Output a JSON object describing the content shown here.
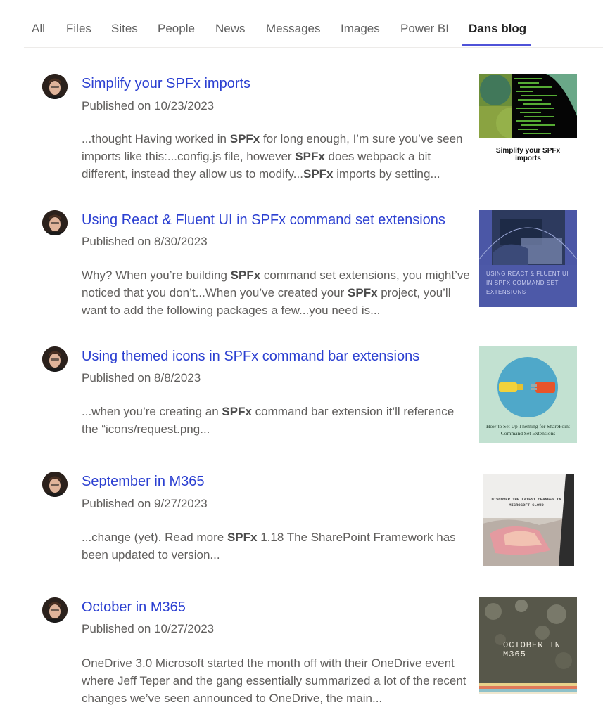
{
  "tabs": [
    {
      "label": "All"
    },
    {
      "label": "Files"
    },
    {
      "label": "Sites"
    },
    {
      "label": "People"
    },
    {
      "label": "News"
    },
    {
      "label": "Messages"
    },
    {
      "label": "Images"
    },
    {
      "label": "Power BI"
    },
    {
      "label": "Dans blog",
      "active": true
    }
  ],
  "published_prefix": "Published on",
  "results": [
    {
      "title": "Simplify your SPFx imports",
      "date": "10/23/2023",
      "snippet": [
        {
          "t": "...thought Having worked in "
        },
        {
          "t": "SPFx",
          "b": true
        },
        {
          "t": " for long enough, I’m sure you’ve seen imports like this:...config.js file, however "
        },
        {
          "t": "SPFx",
          "b": true
        },
        {
          "t": " does webpack a bit different, instead they allow us to modify..."
        },
        {
          "t": "SPFx",
          "b": true
        },
        {
          "t": " imports by setting..."
        }
      ],
      "thumb_caption": "Simplify your SPFx imports"
    },
    {
      "title": "Using React & Fluent UI in SPFx command set extensions",
      "date": "8/30/2023",
      "snippet": [
        {
          "t": "Why? When you’re building "
        },
        {
          "t": "SPFx",
          "b": true
        },
        {
          "t": " command set extensions, you might’ve noticed that you don’t...When you’ve created your "
        },
        {
          "t": "SPFx",
          "b": true
        },
        {
          "t": " project, you’ll want to add the following packages a few...you need is..."
        }
      ],
      "thumb_caption": "USING REACT & FLUENT UI IN SPFX COMMAND SET EXTENSIONS"
    },
    {
      "title": "Using themed icons in SPFx command bar extensions",
      "date": "8/8/2023",
      "snippet": [
        {
          "t": "...when you’re creating an "
        },
        {
          "t": "SPFx",
          "b": true
        },
        {
          "t": " command bar extension it’ll reference the “icons/request.png..."
        }
      ],
      "thumb_caption": "How to Set Up Theming for SharePoint Command Set Extensions"
    },
    {
      "title": "September in M365",
      "date": "9/27/2023",
      "snippet": [
        {
          "t": "...change (yet). Read more "
        },
        {
          "t": "SPFx",
          "b": true
        },
        {
          "t": " 1.18 The SharePoint Framework has been updated to version..."
        }
      ],
      "thumb_caption": "DISCOVER THE LATEST CHANGES IN MICROSOFT CLOUD"
    },
    {
      "title": "October in M365",
      "date": "10/27/2023",
      "snippet": [
        {
          "t": "OneDrive 3.0 Microsoft started the month off with their OneDrive event where Jeff Teper and the gang essentially summarized a lot of the recent changes we’ve seen announced to OneDrive, the main..."
        }
      ],
      "thumb_caption": "OCTOBER IN M365"
    }
  ],
  "colors": {
    "accent": "#4f52d8",
    "title_link": "#2b3fd1"
  }
}
